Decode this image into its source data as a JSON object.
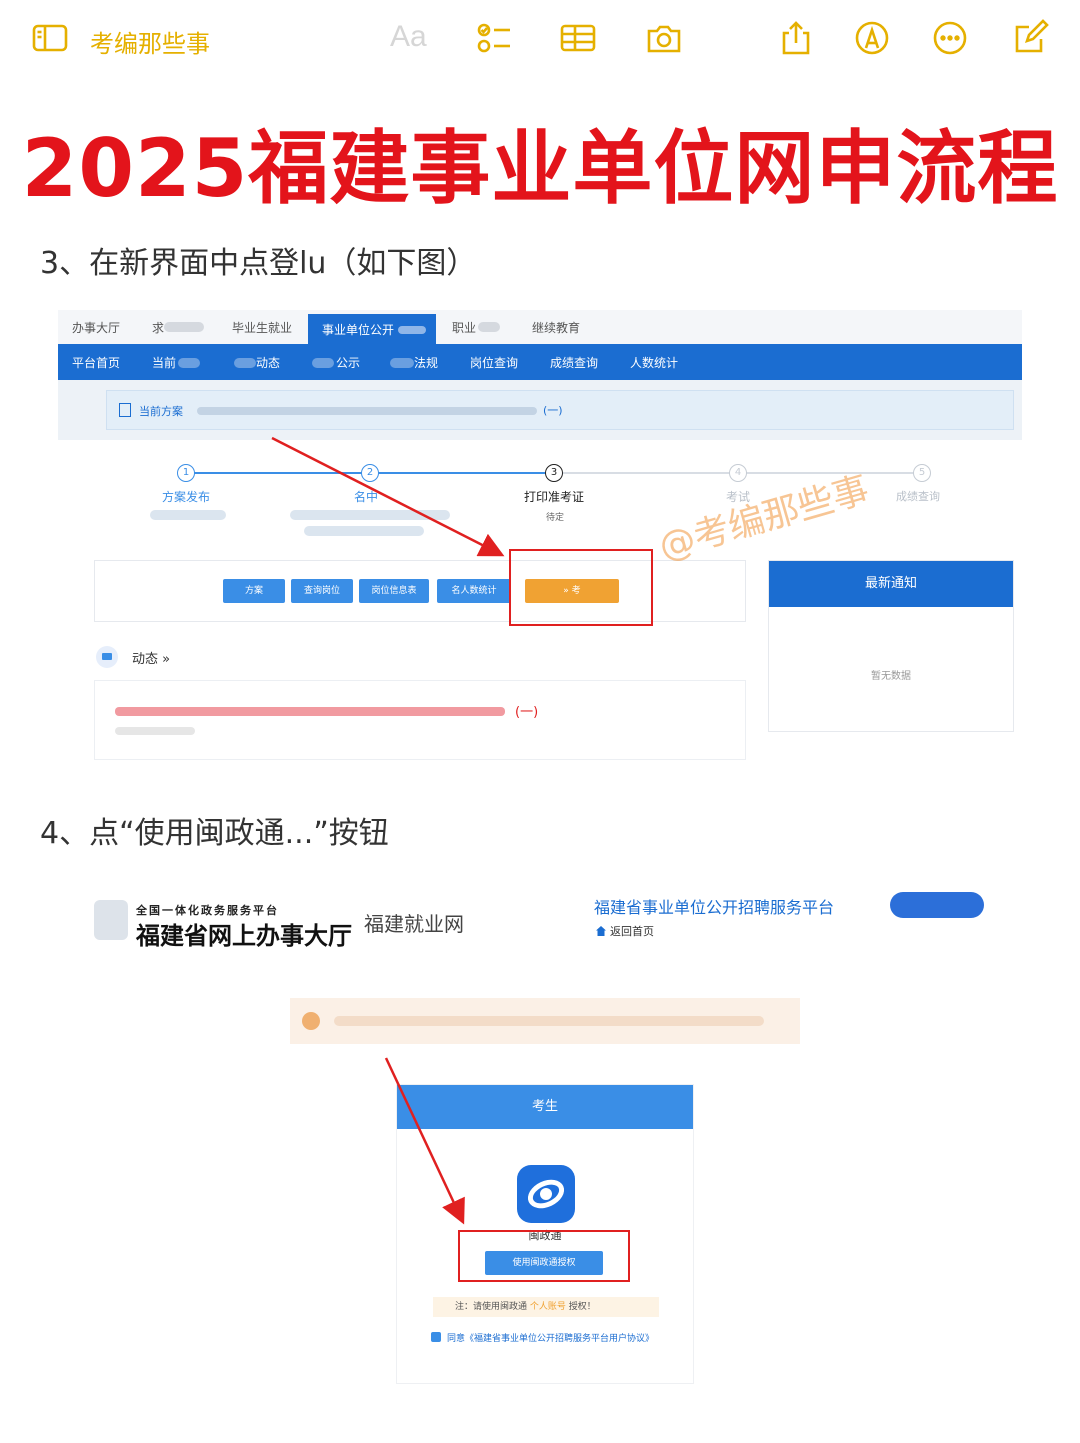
{
  "toolbar": {
    "folder_label": "考编那些事",
    "format_label": "Aa",
    "icons": [
      "sidebar-icon",
      "checklist-icon",
      "table-icon",
      "camera-icon",
      "share-icon",
      "markup-icon",
      "more-icon",
      "compose-icon"
    ],
    "accent_color": "#e5b000"
  },
  "headline": "2025福建事业单位网申流程",
  "steps": {
    "step3": "3、在新界面中点登lu（如下图）",
    "step4": "4、点“使用闽政通...”按钮"
  },
  "screenshot1": {
    "top_tabs": [
      "办事大厅",
      "求",
      "毕业生就业",
      "事业单位公开",
      "职业",
      "继续教育"
    ],
    "blue_nav": [
      "平台首页",
      "当前",
      "动态",
      "公示",
      "法规",
      "岗位查询",
      "成绩查询",
      "人数统计"
    ],
    "current_label": "当前方案",
    "current_tail": "(一)",
    "progress_steps": [
      {
        "num": "1",
        "label": "方案发布"
      },
      {
        "num": "2",
        "label": "名中"
      },
      {
        "num": "3",
        "label": "打印准考证",
        "status": "待定"
      },
      {
        "num": "4",
        "label": "考试"
      },
      {
        "num": "5",
        "label": "成绩查询"
      }
    ],
    "buttons": [
      "方案",
      "查询岗位",
      "岗位信息表",
      "名人数统计",
      "考"
    ],
    "notice_title": "最新通知",
    "notice_empty": "暂无数据",
    "dynamics_title": "动态",
    "dynamics_chevron": "»",
    "dynamics_item_tail": "(一)",
    "watermark": "@考编那些事"
  },
  "screenshot2": {
    "gov_small": "全国一体化政务服务平台",
    "gov_big": "福建省网上办事大厅",
    "fujian_job": "福建就业网",
    "platform_title": "福建省事业单位公开招聘服务平台",
    "home_link": "返回首页",
    "login_title": "考生",
    "app_name": "闽政通",
    "auth_button": "使用闽政通授权",
    "tip_prefix": "注：请使用闽政通",
    "tip_highlight": "个人账号",
    "tip_suffix": "授权！",
    "agree_text": "同意《福建省事业单位公开招聘服务平台用户协议》"
  },
  "colors": {
    "headline_red": "#e3141b",
    "nav_blue": "#1b6dd1",
    "button_blue": "#3a8ee6",
    "button_orange": "#f0a233",
    "highlight_red": "#e02020"
  }
}
